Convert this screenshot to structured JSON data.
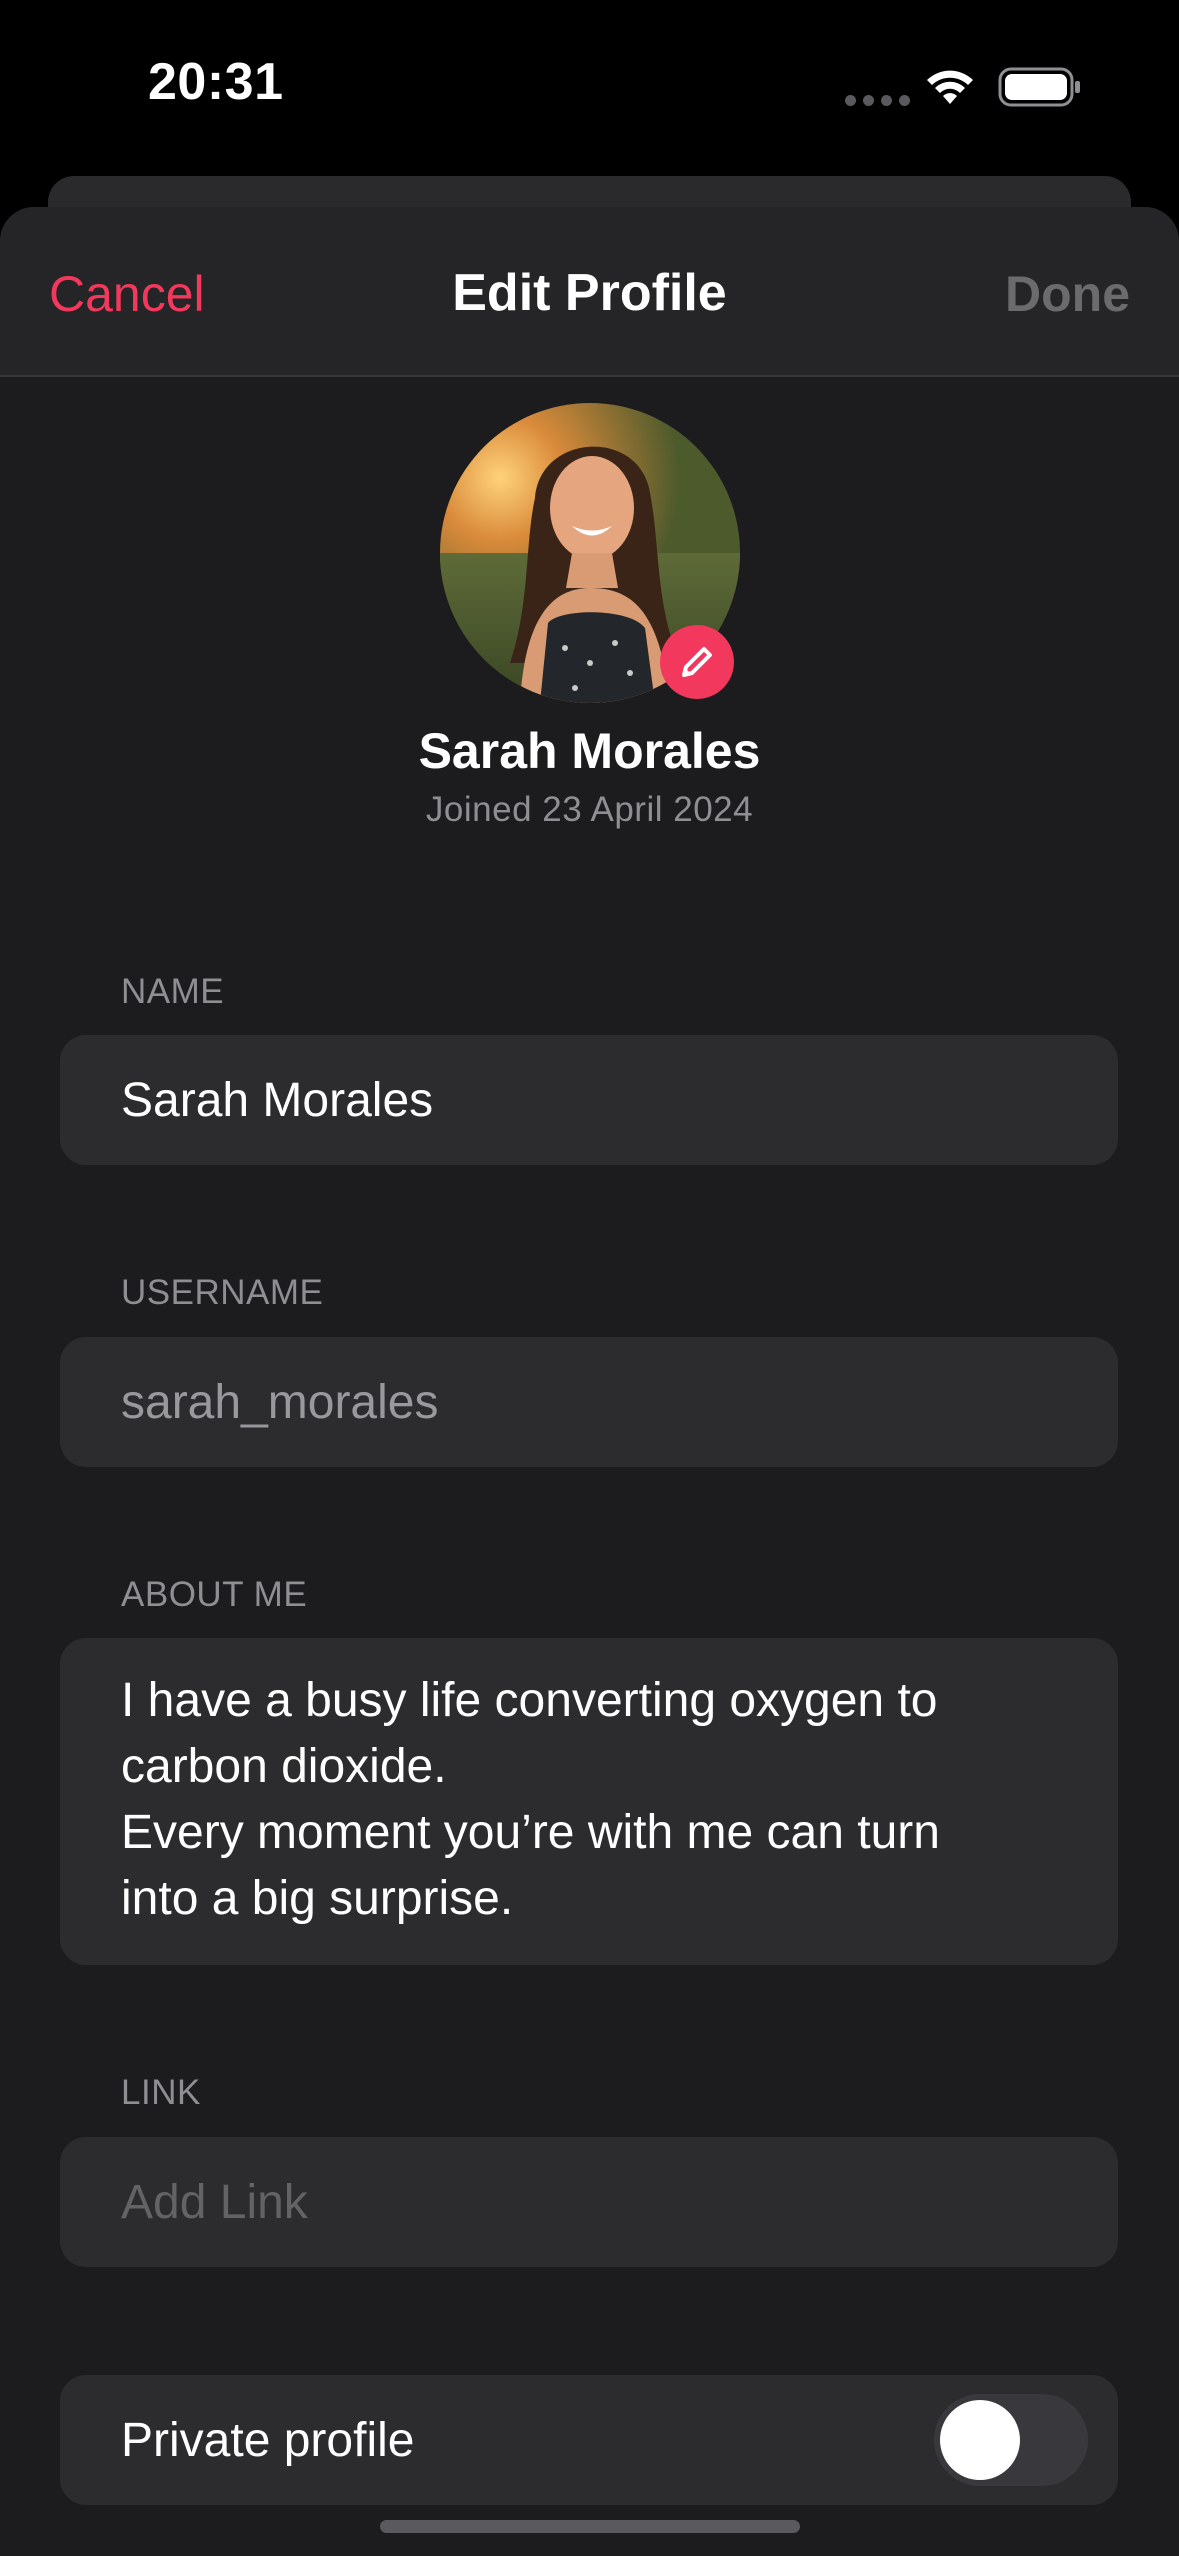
{
  "status_bar": {
    "time": "20:31",
    "wifi_icon": "wifi-icon",
    "battery_icon": "battery-icon"
  },
  "nav": {
    "cancel_label": "Cancel",
    "title": "Edit Profile",
    "done_label": "Done"
  },
  "profile": {
    "avatar_icon": "avatar-photo",
    "edit_icon": "pencil-icon",
    "name": "Sarah Morales",
    "joined": "Joined 23 April 2024"
  },
  "form": {
    "name": {
      "label": "NAME",
      "value": "Sarah Morales"
    },
    "username": {
      "label": "USERNAME",
      "value": "sarah_morales"
    },
    "about": {
      "label": "ABOUT ME",
      "value": "I have a busy life converting oxygen to\ncarbon dioxide.\nEvery moment you’re with me can turn\ninto a big surprise."
    },
    "link": {
      "label": "LINK",
      "placeholder": "Add Link"
    },
    "private_profile": {
      "label": "Private profile",
      "enabled": false
    }
  },
  "colors": {
    "accent": "#f2385c",
    "background": "#1c1c1e",
    "field_background": "#2c2c2e",
    "secondary_text": "#8e8e93"
  }
}
